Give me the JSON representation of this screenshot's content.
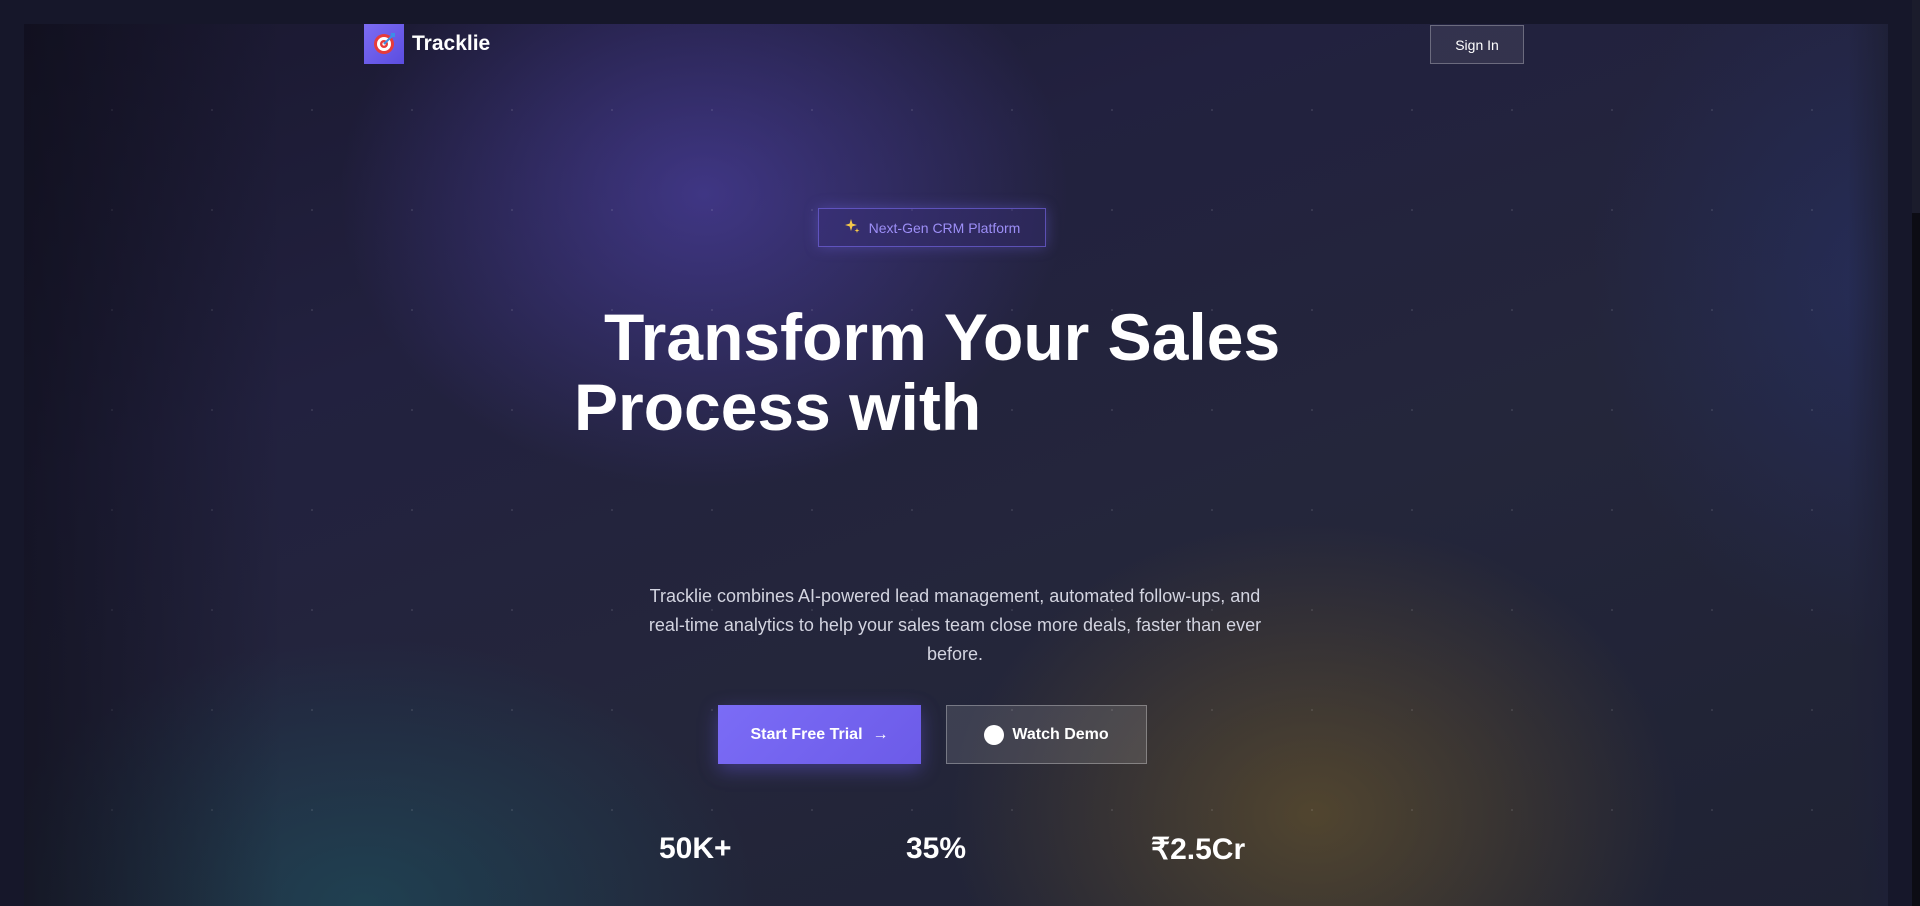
{
  "brand": {
    "name": "Tracklie",
    "icon": "target-icon",
    "accent": "#7b6cf6"
  },
  "nav": {
    "signin_label": "Sign In"
  },
  "hero": {
    "badge": {
      "icon": "sparkles-icon",
      "label": "Next-Gen CRM Platform"
    },
    "headline_line1": "Transform Your Sales",
    "headline_line2": "Process with",
    "subtext": "Tracklie combines AI-powered lead management, automated follow-ups, and real-time analytics to help your sales team close more deals, faster than ever before.",
    "primary_cta": {
      "label": "Start Free Trial",
      "icon": "arrow-right-icon",
      "arrow": "→"
    },
    "secondary_cta": {
      "label": "Watch Demo",
      "icon": "play-icon"
    }
  },
  "stats": [
    {
      "value": "50K+"
    },
    {
      "value": "35%"
    },
    {
      "value": "₹2.5Cr"
    }
  ]
}
